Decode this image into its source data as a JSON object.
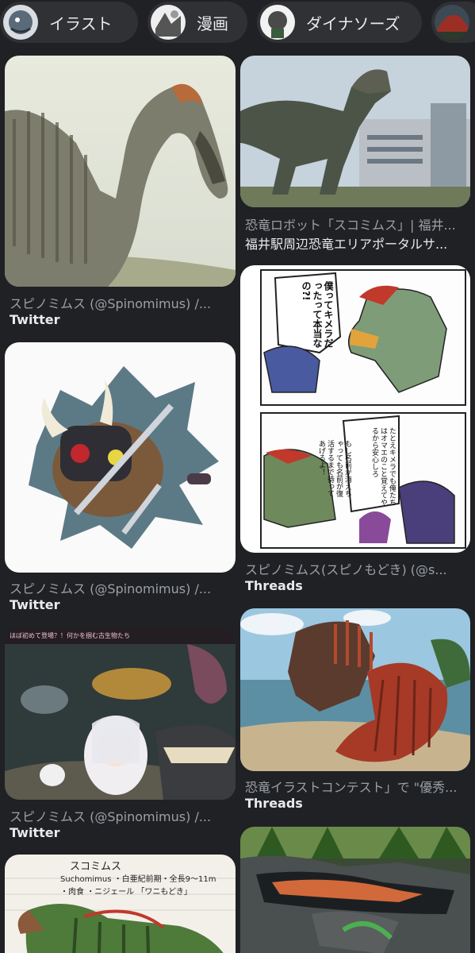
{
  "chips": [
    {
      "label": "イラスト",
      "icon": "dinosaur-thumbnail-icon"
    },
    {
      "label": "漫画",
      "icon": "manga-thumbnail-icon"
    },
    {
      "label": "ダイナソーズ",
      "icon": "dinosaurs-thumbnail-icon"
    },
    {
      "label": "",
      "icon": "red-dinosaur-thumbnail-icon"
    }
  ],
  "results": [
    {
      "title": "スピノミムス (@Spinomimus) /...",
      "source": "Twitter",
      "image": "spinosaurus-painting"
    },
    {
      "title": "恐竜ロボット「スコミムス」| 福井...",
      "source": "福井駅周辺恐竜エリアポータルサ...",
      "image": "dinosaur-robot-station-photo"
    },
    {
      "title": "スピノミムス (@Spinomimus) /...",
      "source": "Twitter",
      "image": "chibi-warrior-illustration"
    },
    {
      "title": "スピノミムス(スピノもどき) (@s...",
      "source": "Threads",
      "image": "dinosaur-manga-panel",
      "manga_text": [
        "僕ってキメラだったって本当なの?!",
        "たとえキメラでも俺たちはオマエのこと覚えてやるから安心しろ",
        "もし名前が消えちゃっても名前が復活するまで待ってあげるよ！"
      ]
    },
    {
      "title": "スピノミムス (@Spinomimus) /...",
      "source": "Twitter",
      "image": "ancient-sea-creatures-illustration",
      "banner_text": "ほぼ初めて登場？！何かを掴む古生物たち"
    },
    {
      "title": "恐竜イラストコンテスト」で \"優秀...",
      "source": "Threads",
      "image": "spinosaurus-dimetrodon-painting"
    },
    {
      "title": "",
      "source": "",
      "image": "suchomimus-notebook-drawing",
      "notes": [
        "スコミムス",
        "Suchomimus ・白亜紀前期・全長9～11m",
        "・肉食 ・ニジェール 「ワニもどき」"
      ]
    },
    {
      "title": "",
      "source": "",
      "image": "crocodile-dinosaur-painting"
    }
  ],
  "colors": {
    "background": "#202124",
    "chip": "#303134",
    "title": "#9aa0a6",
    "source": "#e8eaed"
  }
}
